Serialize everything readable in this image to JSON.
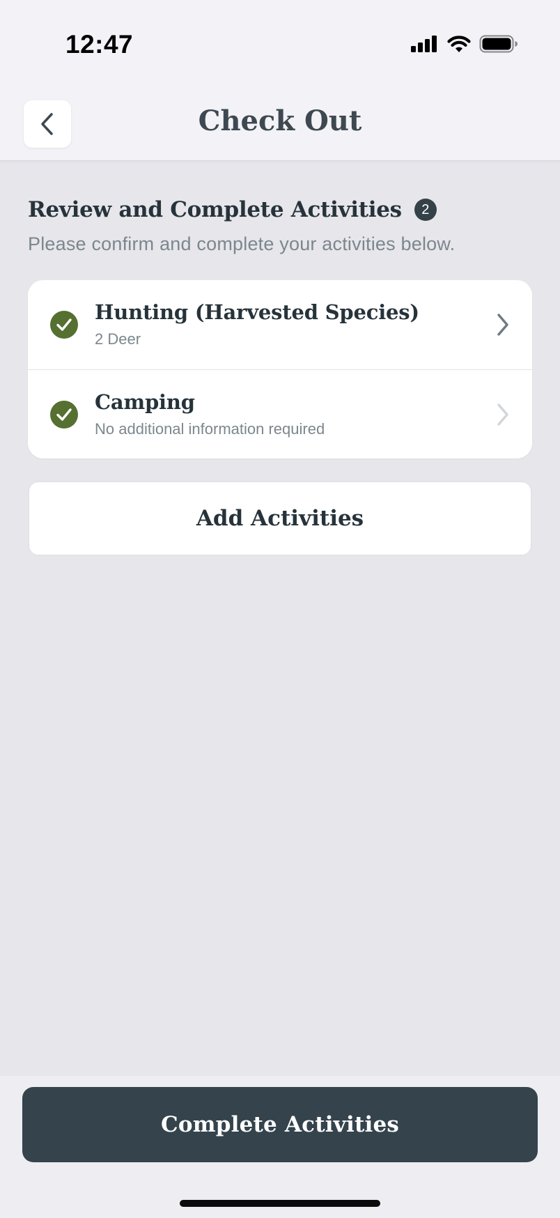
{
  "status_bar": {
    "time": "12:47",
    "icons": [
      "signal-icon",
      "wifi-icon",
      "battery-icon"
    ]
  },
  "header": {
    "back_icon": "chevron-left-icon",
    "title": "Check Out"
  },
  "section": {
    "title": "Review and Complete Activities",
    "count": "2",
    "subtitle": "Please confirm and complete your activities below."
  },
  "activities": [
    {
      "title": "Hunting (Harvested Species)",
      "subtitle": "2 Deer",
      "status_icon": "check-circle-icon",
      "chevron_color": "#6f7a80"
    },
    {
      "title": "Camping",
      "subtitle": "No additional information required",
      "status_icon": "check-circle-icon",
      "chevron_color": "#d2d6d9"
    }
  ],
  "add_button_label": "Add Activities",
  "complete_button_label": "Complete Activities",
  "colors": {
    "accent_green": "#557030",
    "primary_dark": "#34434c",
    "background": "#e6e6eb"
  }
}
